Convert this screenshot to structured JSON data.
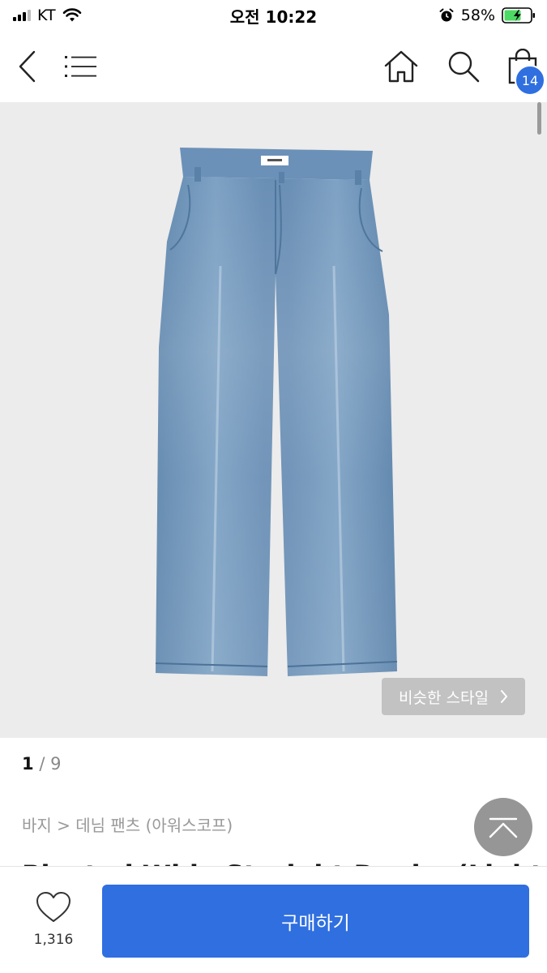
{
  "status_bar": {
    "carrier": "KT",
    "time": "오전 10:22",
    "battery": "58%"
  },
  "nav": {
    "cart_count": "14"
  },
  "product": {
    "similar_style_label": "비슷한 스타일",
    "image_index": "1",
    "image_total": "/ 9",
    "breadcrumb": "바지 > 데님 팬츠 (아워스코프)",
    "title": "Pleated Wide Straight Denim (Light Blue)"
  },
  "bottom_bar": {
    "like_count": "1,316",
    "buy_label": "구매하기"
  },
  "colors": {
    "accent": "#2f6fe0",
    "image_bg": "#ececec"
  }
}
